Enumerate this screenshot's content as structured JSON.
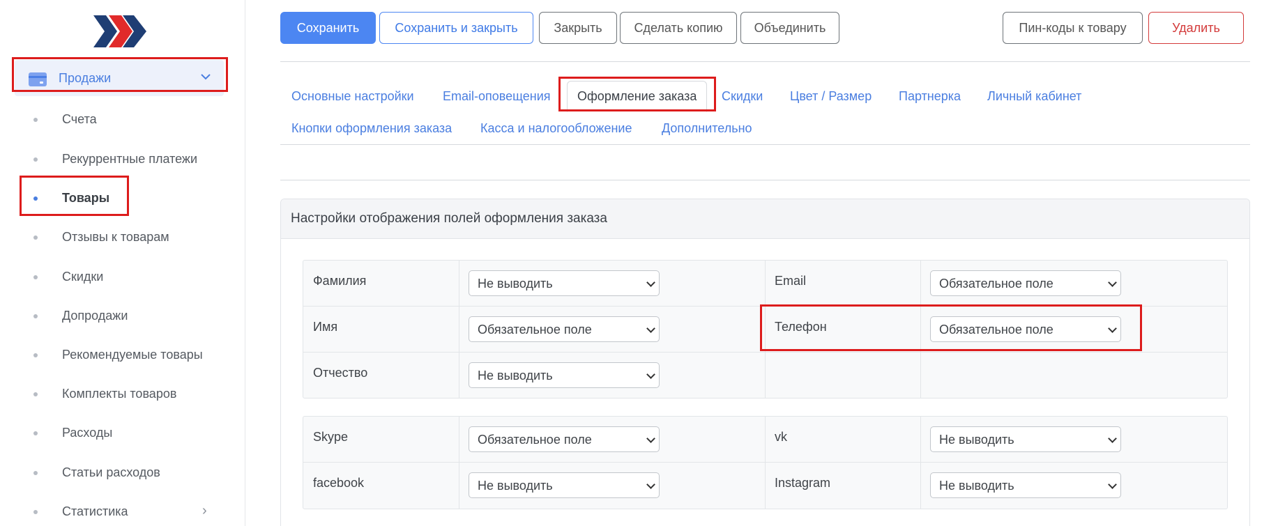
{
  "colors": {
    "accent": "#4c86f2",
    "danger": "#d33a3a",
    "highlight": "#dd1c1c"
  },
  "sidebar": {
    "logo": "chevrons-logo",
    "section": {
      "label": "Продажи",
      "icon": "wallet-icon",
      "chevron": "⌄"
    },
    "items": [
      {
        "label": "Счета",
        "active": false
      },
      {
        "label": "Рекуррентные платежи",
        "active": false
      },
      {
        "label": "Товары",
        "active": true
      },
      {
        "label": "Отзывы к товарам",
        "active": false
      },
      {
        "label": "Скидки",
        "active": false
      },
      {
        "label": "Допродажи",
        "active": false
      },
      {
        "label": "Рекомендуемые товары",
        "active": false
      },
      {
        "label": "Комплекты товаров",
        "active": false
      },
      {
        "label": "Расходы",
        "active": false
      },
      {
        "label": "Статьи расходов",
        "active": false
      },
      {
        "label": "Статистика",
        "active": false,
        "arrow": "›"
      }
    ]
  },
  "toolbar": {
    "save": "Сохранить",
    "save_close": "Сохранить и закрыть",
    "close": "Закрыть",
    "copy": "Сделать копию",
    "merge": "Объединить",
    "pincodes": "Пин-коды к товару",
    "delete": "Удалить"
  },
  "tabs": {
    "row1": [
      "Основные настройки",
      "Email-оповещения",
      "Оформление заказа",
      "Скидки",
      "Цвет / Размер",
      "Партнерка",
      "Личный кабинет"
    ],
    "row2": [
      "Кнопки оформления заказа",
      "Касса и налогообложение",
      "Дополнительно"
    ],
    "current": "Оформление заказа"
  },
  "panel": {
    "title": "Настройки отображения полей оформления заказа",
    "fields_main": [
      {
        "left_label": "Фамилия",
        "left_value": "Не выводить",
        "right_label": "Email",
        "right_value": "Обязательное поле"
      },
      {
        "left_label": "Имя",
        "left_value": "Обязательное поле",
        "right_label": "Телефон",
        "right_value": "Обязательное поле"
      },
      {
        "left_label": "Отчество",
        "left_value": "Не выводить",
        "right_label": "",
        "right_value": ""
      }
    ],
    "fields_social": [
      {
        "left_label": "Skype",
        "left_value": "Обязательное поле",
        "right_label": "vk",
        "right_value": "Не выводить"
      },
      {
        "left_label": "facebook",
        "left_value": "Не выводить",
        "right_label": "Instagram",
        "right_value": "Не выводить"
      }
    ]
  }
}
